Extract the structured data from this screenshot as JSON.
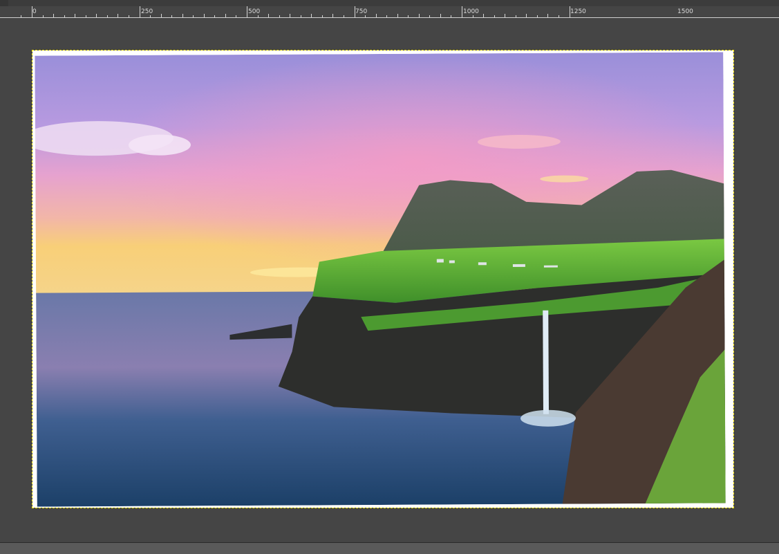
{
  "ruler": {
    "labels": [
      "0",
      "250",
      "500",
      "750",
      "1000",
      "1250",
      "1500"
    ]
  },
  "colors": {
    "workspace": "#454545",
    "selection": "#f0e000",
    "sky_top": "#8f8fd8",
    "sky_pink": "#e7a0d0",
    "sunset": "#f6c46a",
    "sea": "#2a4c7a",
    "grass": "#5fb83a"
  }
}
